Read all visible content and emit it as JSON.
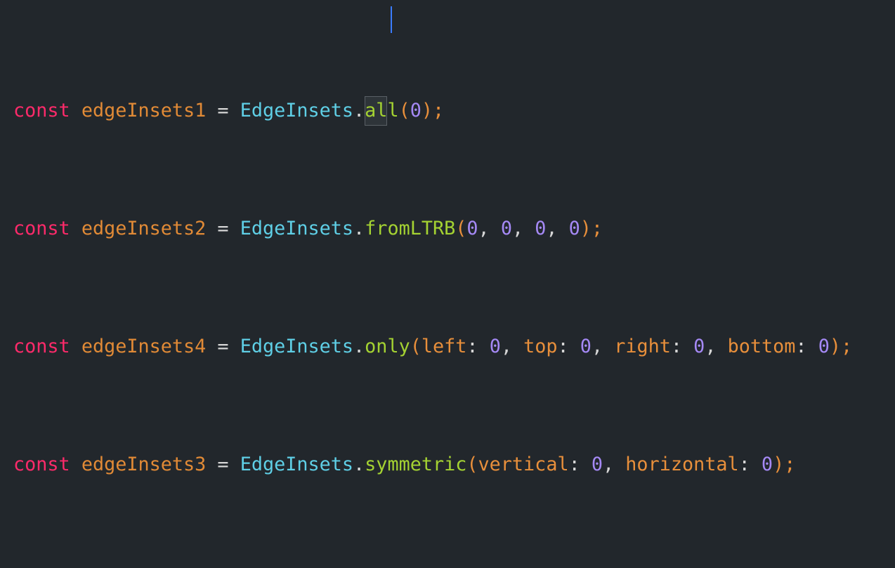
{
  "colors": {
    "background": "#22272c",
    "keyword": "#fc2a6a",
    "variable": "#e18a36",
    "class": "#5fcfe6",
    "method": "#a4d232",
    "number": "#a589f5",
    "named_arg": "#e88f3b",
    "punctuation": "#d6d6d6",
    "cursor": "#3b7cff"
  },
  "code": {
    "lines": [
      {
        "keyword": "const",
        "name": "edgeInsets1",
        "op": " = ",
        "cls": "EdgeInsets",
        "dot": ".",
        "method_sel": "al",
        "method_rest": "l",
        "open": "(",
        "n1": "0",
        "close": ");"
      },
      {
        "keyword": "const",
        "name": "edgeInsets2",
        "op": " = ",
        "cls": "EdgeInsets",
        "dot": ".",
        "method": "fromLTRB",
        "open": "(",
        "n1": "0",
        "sep1": ", ",
        "n2": "0",
        "sep2": ", ",
        "n3": "0",
        "sep3": ", ",
        "n4": "0",
        "close": ");"
      },
      {
        "keyword": "const",
        "name": "edgeInsets4",
        "op": " = ",
        "cls": "EdgeInsets",
        "dot": ".",
        "method": "only",
        "open": "(",
        "a1": "left",
        "c1": ": ",
        "n1": "0",
        "sep1": ", ",
        "a2": "top",
        "c2": ": ",
        "n2": "0",
        "sep2": ", ",
        "a3": "right",
        "c3": ": ",
        "n3": "0",
        "sep3": ", ",
        "a4": "bottom",
        "c4": ": ",
        "n4": "0",
        "close": ");"
      },
      {
        "keyword": "const",
        "name": "edgeInsets3",
        "op": " = ",
        "cls": "EdgeInsets",
        "dot": ".",
        "method": "symmetric",
        "open": "(",
        "a1": "vertical",
        "c1": ": ",
        "n1": "0",
        "sep1": ", ",
        "a2": "horizontal",
        "c2": ": ",
        "n2": "0",
        "close": ");"
      }
    ]
  }
}
